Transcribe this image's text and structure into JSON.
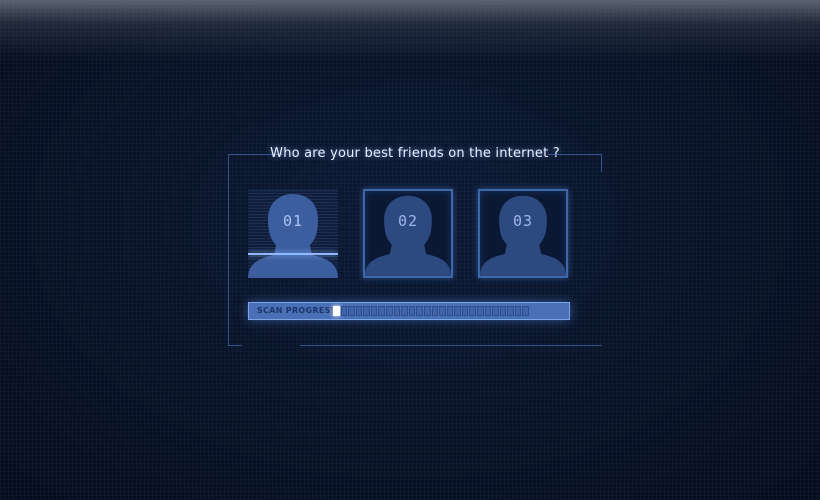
{
  "prompt": {
    "title": "Who are your best friends on the internet ?"
  },
  "cards": [
    {
      "number": "01",
      "state": "scanning"
    },
    {
      "number": "02",
      "state": "idle"
    },
    {
      "number": "03",
      "state": "idle"
    }
  ],
  "scan": {
    "label": "SCAN PROGRESS",
    "progress_fraction": 0.04,
    "segment_count": 26,
    "filled_segments": 1
  },
  "colors": {
    "background": "#091428",
    "accent": "#3e67a8",
    "progress_fill": "#4a71b8",
    "scan_line": "#8fb8ff",
    "title_text": "#eaf1ff"
  }
}
